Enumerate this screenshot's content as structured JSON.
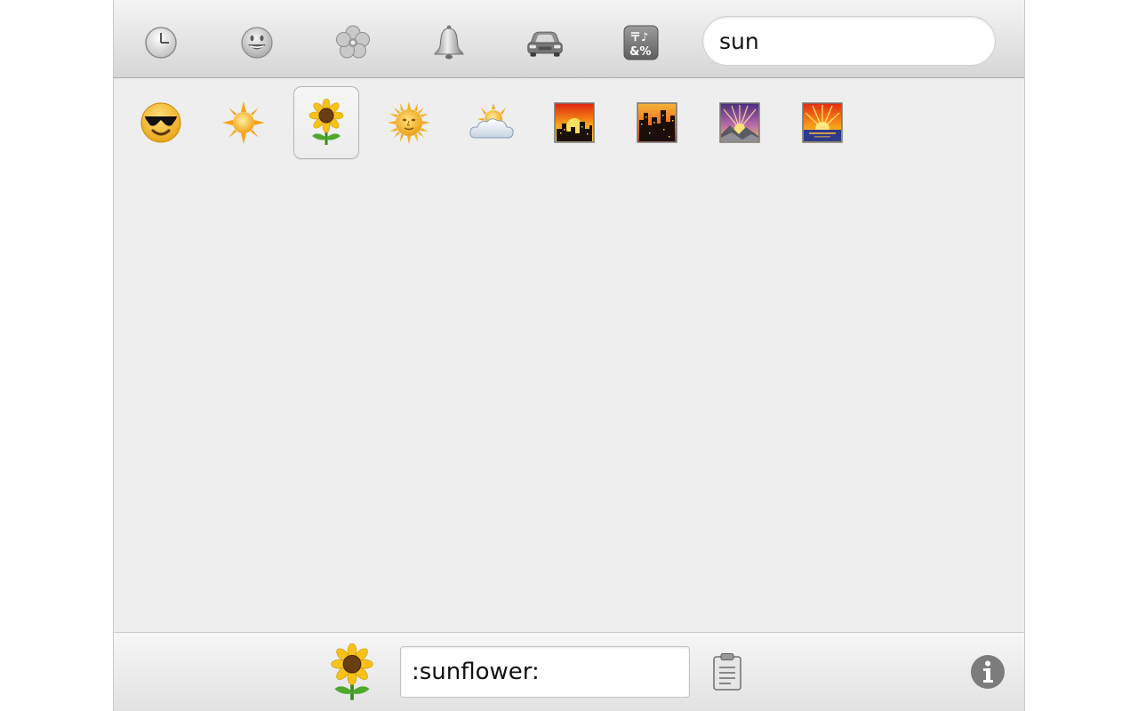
{
  "toolbar": {
    "categories": [
      {
        "icon": "clock-icon",
        "label": "Recents"
      },
      {
        "icon": "smiley-icon",
        "label": "People"
      },
      {
        "icon": "flower-icon",
        "label": "Nature"
      },
      {
        "icon": "bell-icon",
        "label": "Objects"
      },
      {
        "icon": "car-icon",
        "label": "Places"
      },
      {
        "icon": "symbols-icon",
        "label": "Symbols"
      }
    ],
    "search": {
      "value": "sun",
      "placeholder": ""
    }
  },
  "results": [
    {
      "icon": "sunglasses-face-icon"
    },
    {
      "icon": "sun-icon"
    },
    {
      "icon": "sunflower-icon",
      "selected": true
    },
    {
      "icon": "sun-with-face-icon"
    },
    {
      "icon": "sun-behind-cloud-icon"
    },
    {
      "icon": "city-sunset-icon"
    },
    {
      "icon": "city-dusk-icon"
    },
    {
      "icon": "sunrise-over-mountains-icon"
    },
    {
      "icon": "sunrise-icon"
    }
  ],
  "footer": {
    "preview_icon": "sunflower-icon",
    "selected_name": ":sunflower:",
    "copy_icon": "clipboard-icon",
    "info_icon": "info-icon"
  }
}
